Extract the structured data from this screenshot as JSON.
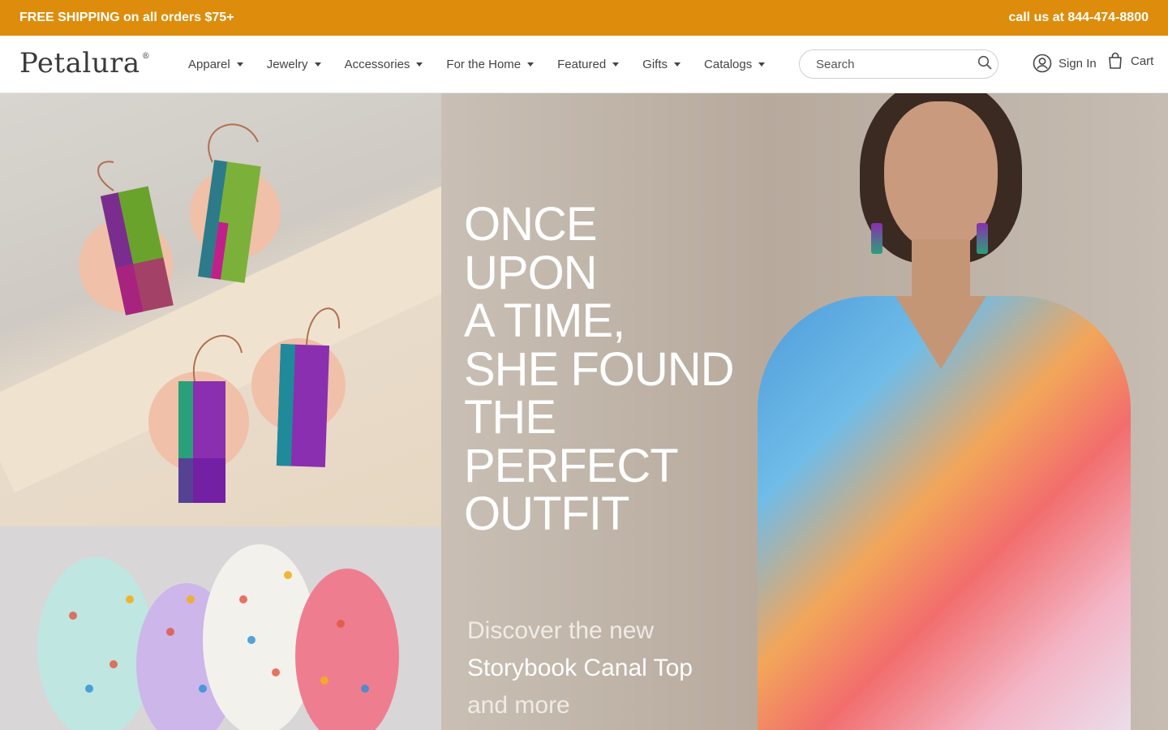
{
  "promo": {
    "shipping": "FREE SHIPPING on all orders $75+",
    "phone": "call us at 844-474-8800"
  },
  "brand": {
    "logo": "Petalura",
    "mark": "®"
  },
  "nav": {
    "items": [
      {
        "label": "Apparel"
      },
      {
        "label": "Jewelry"
      },
      {
        "label": "Accessories"
      },
      {
        "label": "For the Home"
      },
      {
        "label": "Featured"
      },
      {
        "label": "Gifts"
      },
      {
        "label": "Catalogs"
      }
    ]
  },
  "search": {
    "placeholder": "Search",
    "icon": "search-icon"
  },
  "account": {
    "signin": "Sign In",
    "cart": "Cart",
    "user_icon": "user-icon",
    "cart_icon": "bag-icon"
  },
  "hero": {
    "headline": [
      "ONCE",
      "UPON",
      "A TIME,",
      "SHE FOUND",
      "THE",
      "PERFECT",
      "OUTFIT"
    ],
    "sub_line1": "Discover the new",
    "sub_line2": "Storybook Canal Top",
    "sub_line3": "and more"
  },
  "colors": {
    "promo_bg": "#dd8d0b",
    "text": "#444444"
  }
}
